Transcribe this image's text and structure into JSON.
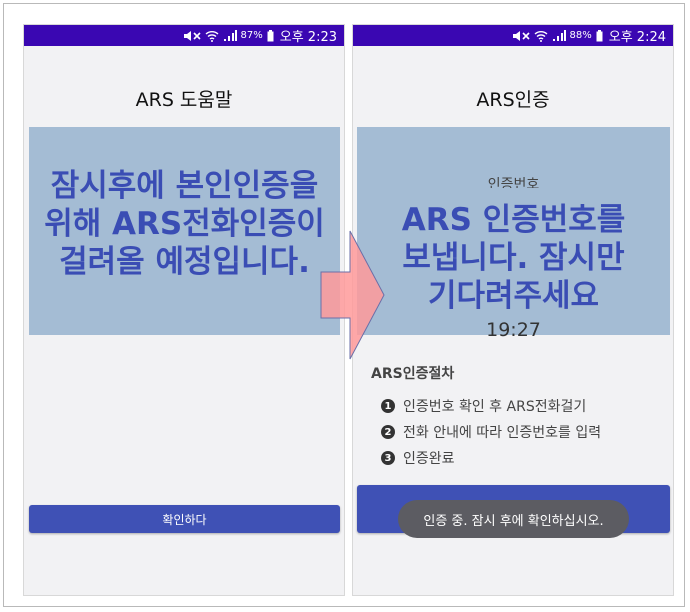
{
  "left_screen": {
    "status": {
      "battery": "87%",
      "time": "오후 2:23"
    },
    "title": "ARS 도움말",
    "overlay_lines": [
      "잠시후에 본인인증을",
      "위해 ARS전화인증이",
      "걸려올 예정입니다."
    ],
    "button_label": "확인하다"
  },
  "right_screen": {
    "status": {
      "battery": "88%",
      "time": "오후 2:24"
    },
    "title": "ARS인증",
    "ghost_label": "인증번호",
    "overlay_lines": [
      "ARS 인증번호를",
      "보냅니다. 잠시만",
      "기다려주세요"
    ],
    "timer": "19:27",
    "procedure_title": "ARS인증절차",
    "steps": [
      {
        "num": "1",
        "text": "인증번호 확인 후 ARS전화걸기"
      },
      {
        "num": "2",
        "text": "전화 안내에 따라 인증번호를 입력"
      },
      {
        "num": "3",
        "text": "인증완료"
      }
    ],
    "toast": "인증 중. 잠시 후에 확인하십시오."
  },
  "colors": {
    "status_bar": "#3a07b2",
    "overlay_bg": "#a4bcd4",
    "overlay_text": "#3a4db4",
    "button": "#3f51b5",
    "arrow": "#ff9a9a"
  },
  "icons": [
    "mute-icon",
    "wifi-icon",
    "signal-icon",
    "battery-icon",
    "arrow-icon"
  ]
}
